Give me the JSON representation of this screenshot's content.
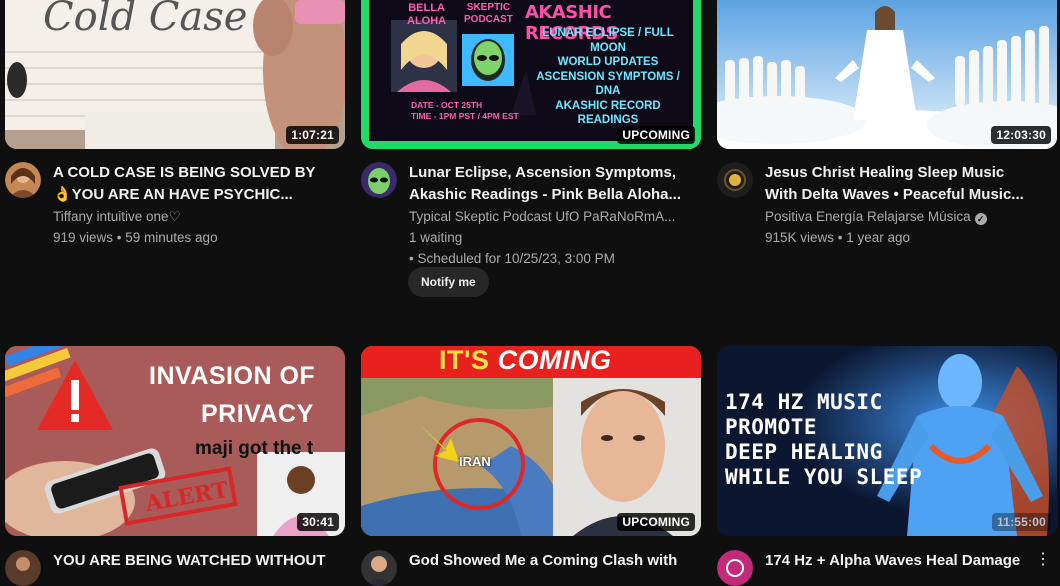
{
  "videos": [
    {
      "thumb_text": "Cold Case",
      "duration": "1:07:21",
      "title_line1": "A COLD CASE IS BEING SOLVED BY",
      "title_line2": "👌YOU ARE AN HAVE PSYCHIC...",
      "channel": "Tiffany intuitive one♡",
      "stats": "919 views • 59 minutes ago"
    },
    {
      "thumb_name1": "BELLA",
      "thumb_name2": "ALOHA",
      "thumb_skeptic1": "SKEPTIC",
      "thumb_skeptic2": "PODCAST",
      "thumb_head": "AKASHIC RECORDS",
      "thumb_l1": "LUNAR ECLIPSE / FULL MOON",
      "thumb_l2": "WORLD UPDATES",
      "thumb_l3": "ASCENSION SYMPTOMS / DNA",
      "thumb_l4": "AKASHIC RECORD",
      "thumb_l5": "READINGS",
      "thumb_date": "DATE - OCT 25TH",
      "thumb_time": "TIME - 1PM PST / 4PM EST",
      "badge": "UPCOMING",
      "title_line1": "Lunar Eclipse, Ascension Symptoms,",
      "title_line2": "Akashic Readings - Pink Bella Aloha...",
      "channel": "Typical Skeptic Podcast UfO PaRaNoRmA...",
      "waiting": "1 waiting",
      "scheduled": "• Scheduled for 10/25/23, 3:00 PM",
      "notify_label": "Notify me"
    },
    {
      "duration": "12:03:30",
      "title_line1": "Jesus Christ Healing Sleep Music",
      "title_line2": "With Delta Waves • Peaceful Music...",
      "channel": "Positiva Energía Relajarse Música",
      "stats": "915K views • 1 year ago"
    },
    {
      "thumb_t1": "INVASION OF",
      "thumb_t2": "PRIVACY",
      "thumb_t3": "maji got the t",
      "thumb_alert": "ALERT",
      "duration": "30:41",
      "title_line1": "YOU ARE BEING WATCHED WITHOUT"
    },
    {
      "thumb_its": "IT'S",
      "thumb_coming": "COMING",
      "thumb_iran": "IRAN",
      "badge": "UPCOMING",
      "title_line1": "God Showed Me a Coming Clash with"
    },
    {
      "thumb_l1": "174 HZ MUSIC",
      "thumb_l2": "PROMOTE",
      "thumb_l3": "DEEP HEALING",
      "thumb_l4": "WHILE YOU SLEEP",
      "duration": "11:55:00",
      "title_line1": "174 Hz + Alpha Waves Heal Damage",
      "more_icon": "⋮"
    }
  ]
}
